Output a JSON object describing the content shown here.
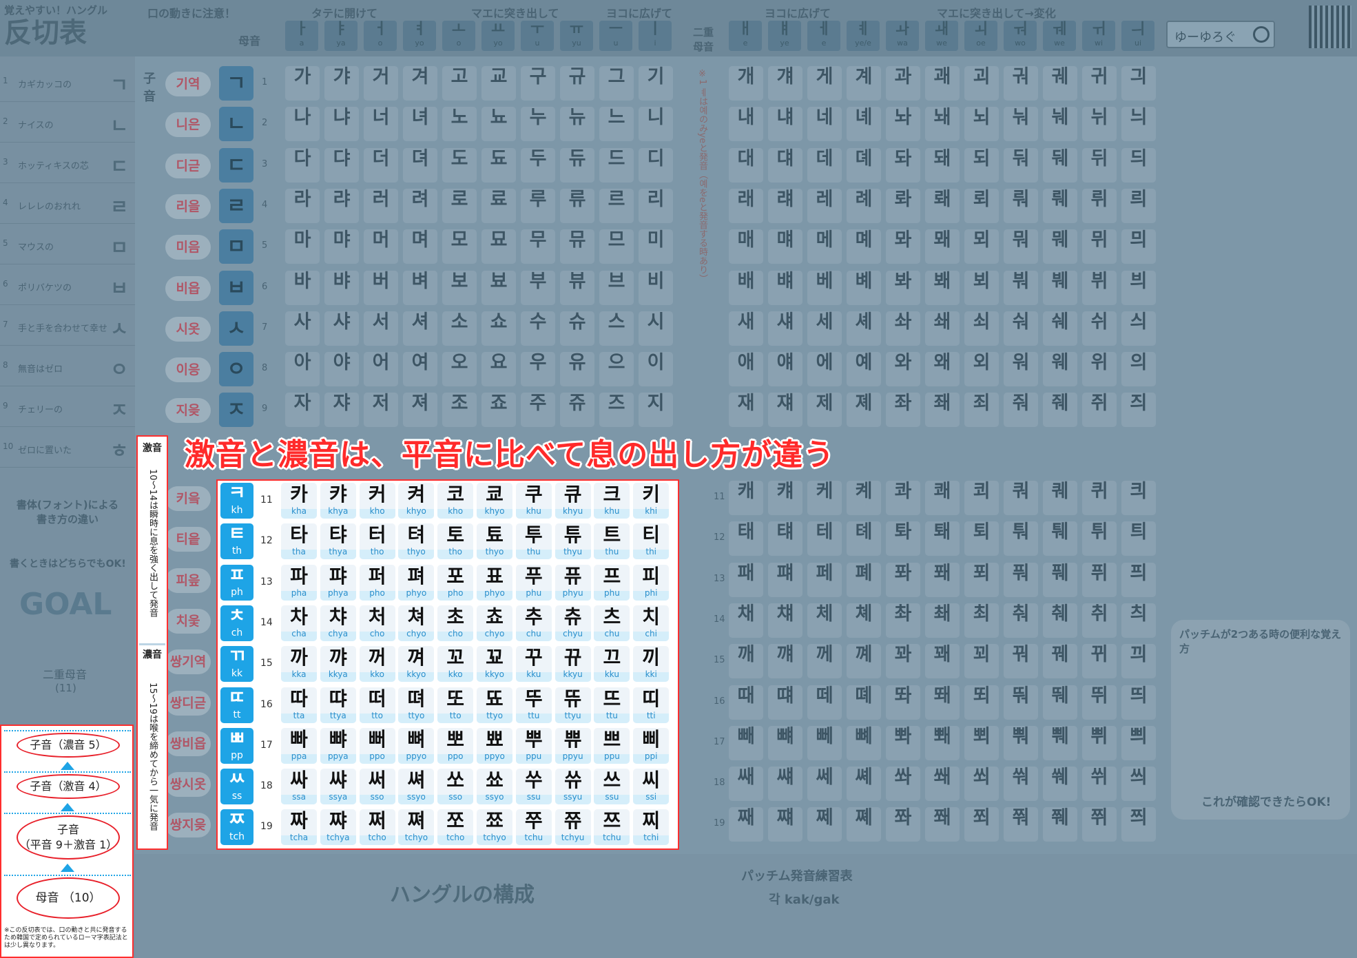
{
  "header": {
    "subtitle": "覚えやすい！ハングル",
    "title": "反切表",
    "mouth_note": "口の動きに注意！",
    "notes": [
      "タテに開けて",
      "マエに突き出して",
      "ヨコに広げて",
      "ヨコに広げて",
      "マエに突き出して→変化"
    ],
    "vowel_label": "母音",
    "diphthong_label": "二重母音",
    "search_placeholder": "ゆーゆろぐ",
    "vowels": [
      {
        "g": "ㅏ",
        "r": "a"
      },
      {
        "g": "ㅑ",
        "r": "ya"
      },
      {
        "g": "ㅓ",
        "r": "o"
      },
      {
        "g": "ㅕ",
        "r": "yo"
      },
      {
        "g": "ㅗ",
        "r": "o"
      },
      {
        "g": "ㅛ",
        "r": "yo"
      },
      {
        "g": "ㅜ",
        "r": "u"
      },
      {
        "g": "ㅠ",
        "r": "yu"
      },
      {
        "g": "ㅡ",
        "r": "u"
      },
      {
        "g": "ㅣ",
        "r": "i"
      }
    ],
    "diphthongs": [
      {
        "g": "ㅐ",
        "r": "e"
      },
      {
        "g": "ㅒ",
        "r": "ye"
      },
      {
        "g": "ㅔ",
        "r": "e"
      },
      {
        "g": "ㅖ",
        "r": "ye/e"
      },
      {
        "g": "ㅘ",
        "r": "wa"
      },
      {
        "g": "ㅙ",
        "r": "we"
      },
      {
        "g": "ㅚ",
        "r": "oe"
      },
      {
        "g": "ㅝ",
        "r": "wo"
      },
      {
        "g": "ㅞ",
        "r": "we"
      },
      {
        "g": "ㅟ",
        "r": "wi"
      },
      {
        "g": "ㅢ",
        "r": "ui"
      }
    ]
  },
  "left_column": [
    {
      "n": "1",
      "t": "カギカッコの",
      "j": "ㄱ"
    },
    {
      "n": "2",
      "t": "ナイスの",
      "j": "ㄴ"
    },
    {
      "n": "3",
      "t": "ホッティキスの芯",
      "j": "ㄷ"
    },
    {
      "n": "4",
      "t": "レレレのおれれ",
      "j": "ㄹ"
    },
    {
      "n": "5",
      "t": "マウスの",
      "j": "ㅁ"
    },
    {
      "n": "6",
      "t": "ポリバケツの",
      "j": "ㅂ"
    },
    {
      "n": "7",
      "t": "手と手を合わせて幸せ",
      "j": "ㅅ"
    },
    {
      "n": "8",
      "t": "無音はゼロ",
      "j": "ㅇ"
    },
    {
      "n": "9",
      "t": "チェリーの",
      "j": "ㅈ"
    },
    {
      "n": "10",
      "t": "ゼロに置いた",
      "j": "ㅎ"
    }
  ],
  "dim_rows": [
    {
      "num": "1",
      "name": "기역",
      "k": "ㄱ",
      "cells": [
        "가",
        "갸",
        "거",
        "겨",
        "고",
        "교",
        "구",
        "규",
        "그",
        "기",
        "개",
        "걔",
        "게",
        "계",
        "과",
        "괘",
        "괴",
        "궈",
        "궤",
        "귀",
        "긔"
      ]
    },
    {
      "num": "2",
      "name": "니은",
      "k": "ㄴ",
      "cells": [
        "나",
        "냐",
        "너",
        "녀",
        "노",
        "뇨",
        "누",
        "뉴",
        "느",
        "니",
        "내",
        "냬",
        "네",
        "녜",
        "놔",
        "놰",
        "뇌",
        "눠",
        "눼",
        "뉘",
        "늬"
      ]
    },
    {
      "num": "3",
      "name": "디귿",
      "k": "ㄷ",
      "cells": [
        "다",
        "댜",
        "더",
        "뎌",
        "도",
        "됴",
        "두",
        "듀",
        "드",
        "디",
        "대",
        "댸",
        "데",
        "뎨",
        "돠",
        "돼",
        "되",
        "둬",
        "뒈",
        "뒤",
        "듸"
      ]
    },
    {
      "num": "4",
      "name": "리을",
      "k": "ㄹ",
      "cells": [
        "라",
        "랴",
        "러",
        "려",
        "로",
        "료",
        "루",
        "류",
        "르",
        "리",
        "래",
        "럐",
        "레",
        "례",
        "롸",
        "뢔",
        "뢰",
        "뤄",
        "뤠",
        "뤼",
        "릐"
      ]
    },
    {
      "num": "5",
      "name": "미음",
      "k": "ㅁ",
      "cells": [
        "마",
        "먀",
        "머",
        "며",
        "모",
        "묘",
        "무",
        "뮤",
        "므",
        "미",
        "매",
        "먜",
        "메",
        "몌",
        "뫄",
        "뫠",
        "뫼",
        "뭐",
        "뭬",
        "뮈",
        "믜"
      ]
    },
    {
      "num": "6",
      "name": "비읍",
      "k": "ㅂ",
      "cells": [
        "바",
        "뱌",
        "버",
        "벼",
        "보",
        "뵤",
        "부",
        "뷰",
        "브",
        "비",
        "배",
        "뱨",
        "베",
        "볘",
        "봐",
        "봬",
        "뵈",
        "붜",
        "붸",
        "뷔",
        "븨"
      ]
    },
    {
      "num": "7",
      "name": "시옷",
      "k": "ㅅ",
      "cells": [
        "사",
        "샤",
        "서",
        "셔",
        "소",
        "쇼",
        "수",
        "슈",
        "스",
        "시",
        "새",
        "섀",
        "세",
        "셰",
        "솨",
        "쇄",
        "쇠",
        "숴",
        "쉐",
        "쉬",
        "싀"
      ]
    },
    {
      "num": "8",
      "name": "이응",
      "k": "ㅇ",
      "cells": [
        "아",
        "야",
        "어",
        "여",
        "오",
        "요",
        "우",
        "유",
        "으",
        "이",
        "애",
        "얘",
        "에",
        "예",
        "와",
        "왜",
        "외",
        "워",
        "웨",
        "위",
        "의"
      ]
    },
    {
      "num": "9",
      "name": "지읒",
      "k": "ㅈ",
      "cells": [
        "자",
        "쟈",
        "저",
        "져",
        "조",
        "죠",
        "주",
        "쥬",
        "즈",
        "지",
        "재",
        "쟤",
        "제",
        "졔",
        "좌",
        "좨",
        "죄",
        "줘",
        "줴",
        "쥐",
        "즤"
      ]
    }
  ],
  "dim_lower_names": [
    "키읔",
    "티읕",
    "피읖",
    "치읓",
    "쌍기역",
    "쌍디귿",
    "쌍비읍",
    "쌍시옷",
    "쌍지읒"
  ],
  "dim_lower_right": [
    [
      "캐",
      "컈",
      "케",
      "켸",
      "콰",
      "쾌",
      "쾨",
      "쿼",
      "퀘",
      "퀴",
      "킈"
    ],
    [
      "태",
      "턔",
      "테",
      "톄",
      "톼",
      "퇘",
      "퇴",
      "퉈",
      "퉤",
      "튀",
      "틔"
    ],
    [
      "패",
      "퍠",
      "페",
      "폐",
      "퐈",
      "퐤",
      "푀",
      "풔",
      "풰",
      "퓌",
      "픠"
    ],
    [
      "채",
      "챼",
      "체",
      "쳬",
      "촤",
      "쵀",
      "최",
      "춰",
      "췌",
      "취",
      "츼"
    ],
    [
      "깨",
      "꺠",
      "께",
      "꼐",
      "꽈",
      "꽤",
      "꾀",
      "꿔",
      "꿰",
      "뀌",
      "끠"
    ],
    [
      "때",
      "떄",
      "떼",
      "뗴",
      "똬",
      "뙈",
      "뙤",
      "뚸",
      "뛔",
      "뛰",
      "띄"
    ],
    [
      "빼",
      "뺴",
      "뻬",
      "뼤",
      "뽜",
      "뽸",
      "뾔",
      "뿨",
      "쀄",
      "쀠",
      "쁴"
    ],
    [
      "쌔",
      "썌",
      "쎄",
      "쎼",
      "쏴",
      "쐐",
      "쐬",
      "쒀",
      "쒜",
      "쒸",
      "씌"
    ],
    [
      "째",
      "쨰",
      "쩨",
      "쪠",
      "쫘",
      "쫴",
      "쬐",
      "쭤",
      "쮀",
      "쮜",
      "쯰"
    ]
  ],
  "caption": "激音と濃音は、平音に比べて息の出し方が違う",
  "side_labels": {
    "gekion_title": "激音",
    "gekion_text": "10〜14は瞬時に息を強く出して発音",
    "noon_title": "濃音",
    "noon_text": "15〜19は喉を締めてから一気に発音"
  },
  "bright_rows": [
    {
      "num": "11",
      "k": "ㅋ",
      "kr": "kh",
      "cells": [
        [
          "카",
          "kha"
        ],
        [
          "캬",
          "khya"
        ],
        [
          "커",
          "kho"
        ],
        [
          "켜",
          "khyo"
        ],
        [
          "코",
          "kho"
        ],
        [
          "쿄",
          "khyo"
        ],
        [
          "쿠",
          "khu"
        ],
        [
          "큐",
          "khyu"
        ],
        [
          "크",
          "khu"
        ],
        [
          "키",
          "khi"
        ]
      ]
    },
    {
      "num": "12",
      "k": "ㅌ",
      "kr": "th",
      "cells": [
        [
          "타",
          "tha"
        ],
        [
          "탸",
          "thya"
        ],
        [
          "터",
          "tho"
        ],
        [
          "텨",
          "thyo"
        ],
        [
          "토",
          "tho"
        ],
        [
          "툐",
          "thyo"
        ],
        [
          "투",
          "thu"
        ],
        [
          "튜",
          "thyu"
        ],
        [
          "트",
          "thu"
        ],
        [
          "티",
          "thi"
        ]
      ]
    },
    {
      "num": "13",
      "k": "ㅍ",
      "kr": "ph",
      "cells": [
        [
          "파",
          "pha"
        ],
        [
          "퍄",
          "phya"
        ],
        [
          "퍼",
          "pho"
        ],
        [
          "펴",
          "phyo"
        ],
        [
          "포",
          "pho"
        ],
        [
          "표",
          "phyo"
        ],
        [
          "푸",
          "phu"
        ],
        [
          "퓨",
          "phyu"
        ],
        [
          "프",
          "phu"
        ],
        [
          "피",
          "phi"
        ]
      ]
    },
    {
      "num": "14",
      "k": "ㅊ",
      "kr": "ch",
      "cells": [
        [
          "차",
          "cha"
        ],
        [
          "챠",
          "chya"
        ],
        [
          "처",
          "cho"
        ],
        [
          "쳐",
          "chyo"
        ],
        [
          "초",
          "cho"
        ],
        [
          "쵸",
          "chyo"
        ],
        [
          "추",
          "chu"
        ],
        [
          "츄",
          "chyu"
        ],
        [
          "츠",
          "chu"
        ],
        [
          "치",
          "chi"
        ]
      ]
    },
    {
      "num": "15",
      "k": "ㄲ",
      "kr": "kk",
      "cells": [
        [
          "까",
          "kka"
        ],
        [
          "꺄",
          "kkya"
        ],
        [
          "꺼",
          "kko"
        ],
        [
          "껴",
          "kkyo"
        ],
        [
          "꼬",
          "kko"
        ],
        [
          "꾜",
          "kkyo"
        ],
        [
          "꾸",
          "kku"
        ],
        [
          "뀨",
          "kkyu"
        ],
        [
          "끄",
          "kku"
        ],
        [
          "끼",
          "kki"
        ]
      ]
    },
    {
      "num": "16",
      "k": "ㄸ",
      "kr": "tt",
      "cells": [
        [
          "따",
          "tta"
        ],
        [
          "땨",
          "ttya"
        ],
        [
          "떠",
          "tto"
        ],
        [
          "뗘",
          "ttyo"
        ],
        [
          "또",
          "tto"
        ],
        [
          "뚀",
          "ttyo"
        ],
        [
          "뚜",
          "ttu"
        ],
        [
          "뜌",
          "ttyu"
        ],
        [
          "뜨",
          "ttu"
        ],
        [
          "띠",
          "tti"
        ]
      ]
    },
    {
      "num": "17",
      "k": "ㅃ",
      "kr": "pp",
      "cells": [
        [
          "빠",
          "ppa"
        ],
        [
          "뺘",
          "ppya"
        ],
        [
          "뻐",
          "ppo"
        ],
        [
          "뼈",
          "ppyo"
        ],
        [
          "뽀",
          "ppo"
        ],
        [
          "뾰",
          "ppyo"
        ],
        [
          "뿌",
          "ppu"
        ],
        [
          "쀼",
          "ppyu"
        ],
        [
          "쁘",
          "ppu"
        ],
        [
          "삐",
          "ppi"
        ]
      ]
    },
    {
      "num": "18",
      "k": "ㅆ",
      "kr": "ss",
      "cells": [
        [
          "싸",
          "ssa"
        ],
        [
          "쌰",
          "ssya"
        ],
        [
          "써",
          "sso"
        ],
        [
          "쎠",
          "ssyo"
        ],
        [
          "쏘",
          "sso"
        ],
        [
          "쑈",
          "ssyo"
        ],
        [
          "쑤",
          "ssu"
        ],
        [
          "쓔",
          "ssyu"
        ],
        [
          "쓰",
          "ssu"
        ],
        [
          "씨",
          "ssi"
        ]
      ]
    },
    {
      "num": "19",
      "k": "ㅉ",
      "kr": "tch",
      "cells": [
        [
          "짜",
          "tcha"
        ],
        [
          "쨔",
          "tchya"
        ],
        [
          "쩌",
          "tcho"
        ],
        [
          "쪄",
          "tchyo"
        ],
        [
          "쪼",
          "tcho"
        ],
        [
          "쬬",
          "tchyo"
        ],
        [
          "쭈",
          "tchu"
        ],
        [
          "쮸",
          "tchyu"
        ],
        [
          "쯔",
          "tchu"
        ],
        [
          "찌",
          "tchi"
        ]
      ]
    }
  ],
  "flow": {
    "step1": "子音（濃音 5）",
    "step2": "子音（激音 4）",
    "step3_a": "子音",
    "step3_b": "（平音 9＋激音 1）",
    "step4": "母音 （10）",
    "footnote": "※この反切表では、口の動きと共に発音するため韓国で定められているローマ字表記法とは少し異なります。"
  },
  "dim_left_extra": {
    "font_note": "書体(フォント)による書き方の違い",
    "font_ok": "書くときはどちらでもOK!",
    "goal": "GOAL",
    "diphthong": "二重母音",
    "diphthong_count": "(11)"
  },
  "bottom": {
    "composition": "ハングルの構成",
    "batchim_title": "パッチム発音練習表",
    "batchim_example": "각 kak/gak",
    "right_note": "パッチムが2つある時の便利な覚え方",
    "right_ok": "これが確認できたらOK!"
  }
}
